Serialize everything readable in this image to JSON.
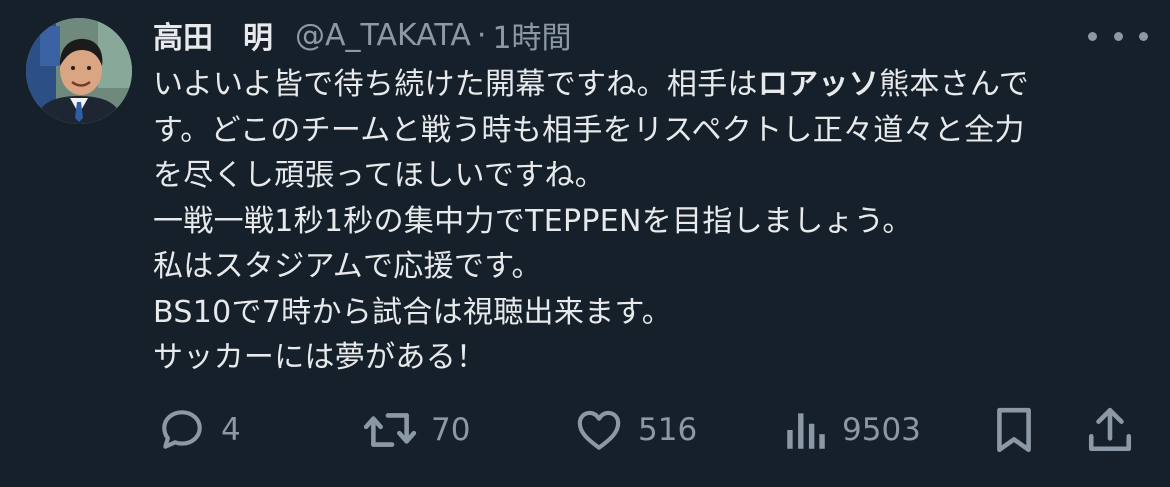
{
  "tweet": {
    "author": {
      "display_name": "高田　明",
      "handle": "@A_TAKATA",
      "separator": "·",
      "time": "1時間"
    },
    "text_lines": [
      {
        "before": "いよいよ皆で待ち続けた開幕ですね。相手は",
        "bold": "ロアッソ",
        "after": "熊本さんで"
      },
      {
        "text": "す。どこのチームと戦う時も相手をリスペクトし正々道々と全力"
      },
      {
        "text": "を尽くし頑張ってほしいですね。"
      },
      {
        "text": "一戦一戦1秒1秒の集中力でTEPPENを目指しましょう。"
      },
      {
        "text": "私はスタジアムで応援です。"
      },
      {
        "text": "BS10で7時から試合は視聴出来ます。"
      },
      {
        "text": "サッカーには夢がある！"
      }
    ],
    "actions": {
      "reply": {
        "icon": "reply-icon",
        "count": "4"
      },
      "retweet": {
        "icon": "retweet-icon",
        "count": "70"
      },
      "like": {
        "icon": "heart-icon",
        "count": "516"
      },
      "views": {
        "icon": "views-icon",
        "count": "9503"
      },
      "bookmark": {
        "icon": "bookmark-icon"
      },
      "share": {
        "icon": "share-icon"
      }
    }
  },
  "colors": {
    "background": "#15202b",
    "text": "#e7e9ea",
    "secondary": "#8b98a5"
  }
}
